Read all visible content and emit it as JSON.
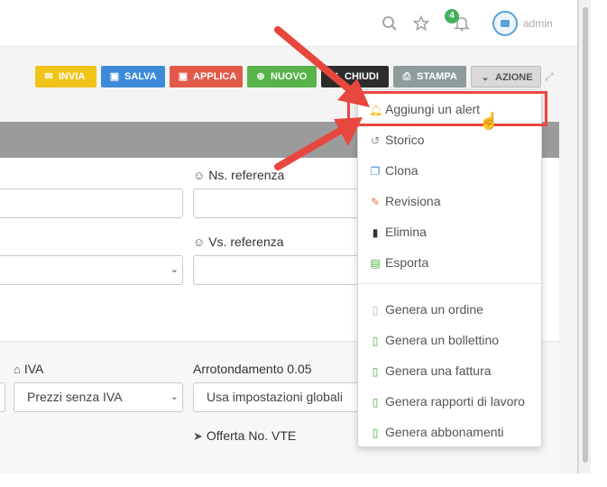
{
  "topbar": {
    "notification_count": "4",
    "user_name": "admin"
  },
  "toolbar": {
    "buttons": [
      {
        "label": "INVIA",
        "icon": "envelope-icon",
        "color": "#f0c418"
      },
      {
        "label": "SALVA",
        "icon": "floppy-icon",
        "color": "#3d8bd8"
      },
      {
        "label": "APPLICA",
        "icon": "floppy-icon",
        "color": "#e2594a"
      },
      {
        "label": "NUOVO",
        "icon": "plus-circle-icon",
        "color": "#57b34a"
      },
      {
        "label": "CHIUDI",
        "icon": "close-icon",
        "color": "#2c2c2c"
      },
      {
        "label": "STAMPA",
        "icon": "printer-icon",
        "color": "#8e9c9c"
      },
      {
        "label": "AZIONE",
        "icon": "chevron-down-icon",
        "color": "#d9d9d9"
      }
    ]
  },
  "form": {
    "ns_referenza_label": "Ns. referenza",
    "vs_referenza_label": "Vs. referenza",
    "iva_label": "IVA",
    "iva_value": "Prezzi senza IVA",
    "arrotondamento_label": "Arrotondamento 0.05",
    "arrotondamento_value": "Usa impostazioni globali",
    "offerta_label": "Offerta No. VTE"
  },
  "menu": {
    "items": [
      {
        "label": "Aggiungi un alert",
        "icon": "bell-icon",
        "color": "#f0b400"
      },
      {
        "label": "Storico",
        "icon": "history-icon",
        "color": "#8a8a8a"
      },
      {
        "label": "Clona",
        "icon": "copy-icon",
        "color": "#3d8bd8"
      },
      {
        "label": "Revisiona",
        "icon": "edit-icon",
        "color": "#e8763a"
      },
      {
        "label": "Elimina",
        "icon": "trash-icon",
        "color": "#333333"
      },
      {
        "label": "Esporta",
        "icon": "excel-file-icon",
        "color": "#4cae3f"
      },
      {
        "label": "Genera un ordine",
        "icon": "file-icon",
        "color": "#b5b5b5"
      },
      {
        "label": "Genera un bollettino",
        "icon": "file-icon",
        "color": "#4cae3f"
      },
      {
        "label": "Genera una fattura",
        "icon": "file-icon",
        "color": "#4cae3f"
      },
      {
        "label": "Genera rapporti di lavoro",
        "icon": "file-icon",
        "color": "#4cae3f"
      },
      {
        "label": "Genera abbonamenti",
        "icon": "file-icon",
        "color": "#4cae3f"
      }
    ]
  },
  "annotation": {
    "arrow_color": "#e8473e",
    "highlight_color": "#e8473e"
  }
}
